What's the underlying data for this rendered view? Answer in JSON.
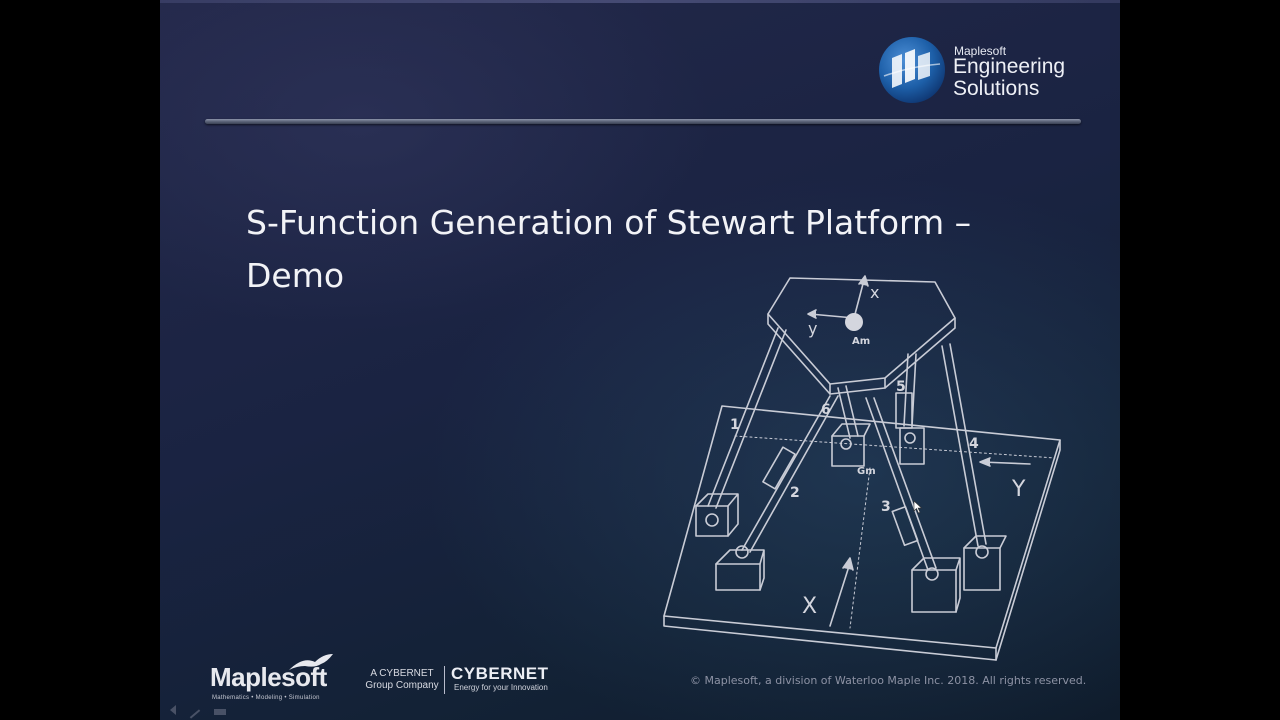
{
  "brand": {
    "small": "Maplesoft",
    "line1": "Engineering",
    "line2": "Solutions",
    "icon": "globe-logo-icon"
  },
  "slide": {
    "title_line1": "S-Function Generation of Stewart Platform –",
    "title_line2": "Demo"
  },
  "figure": {
    "labels": {
      "x_top": "x",
      "y_top": "y",
      "am": "Am",
      "gm": "Gm",
      "leg1": "1",
      "leg2": "2",
      "leg3": "3",
      "leg4": "4",
      "leg5": "5",
      "leg6": "6",
      "X": "X",
      "Y": "Y"
    }
  },
  "footer": {
    "maplesoft": "Maplesoft",
    "maplesoft_tag": "Mathematics • Modeling • Simulation",
    "cybernet_small_1": "A CYBERNET",
    "cybernet_small_2": "Group Company",
    "cybernet": "CYBERNET",
    "cybernet_tag": "Energy for your Innovation",
    "copyright": "© Maplesoft, a division of Waterloo Maple Inc. 2018.  All rights reserved."
  },
  "colors": {
    "background": "#1a2342",
    "title": "#f2f3f7",
    "figure_lines": "#c9ccd6",
    "brand_blue": "#1d5fa8"
  }
}
